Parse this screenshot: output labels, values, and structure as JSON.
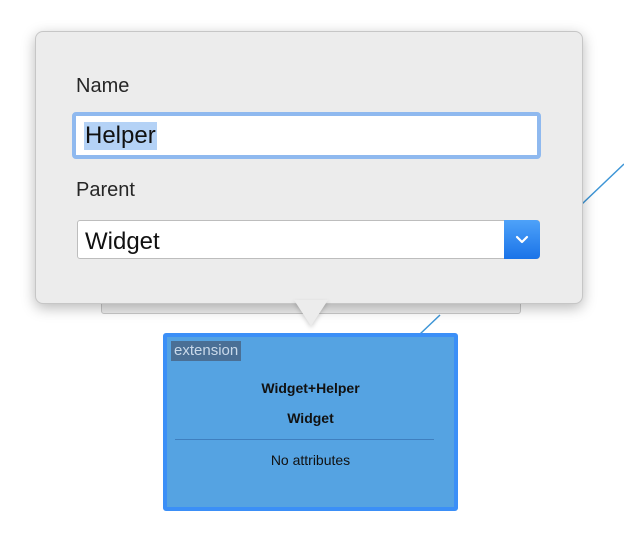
{
  "popover": {
    "name_label": "Name",
    "name_value": "Helper",
    "parent_label": "Parent",
    "parent_value": "Widget"
  },
  "entity": {
    "tag": "extension",
    "title": "Widget+Helper",
    "parent": "Widget",
    "attributes": "No attributes"
  },
  "colors": {
    "accent": "#3b8ff7",
    "entity_fill": "#55a3e2",
    "connector": "#3d95d6"
  },
  "icons": {
    "select_arrow": "chevron-down-icon"
  }
}
